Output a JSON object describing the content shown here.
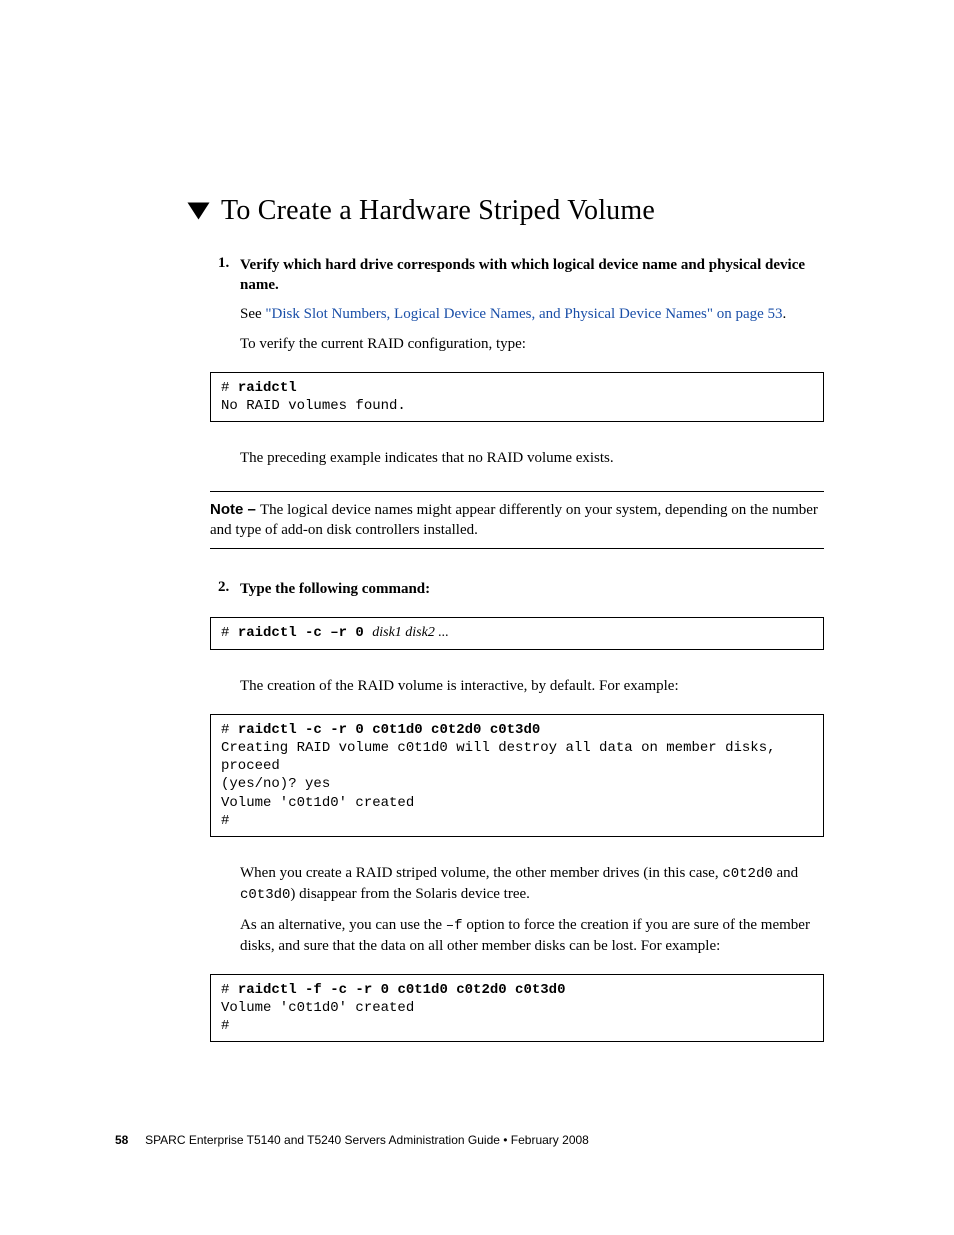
{
  "heading": "To Create a Hardware Striped Volume",
  "step1": {
    "num": "1.",
    "title": "Verify which hard drive corresponds with which logical device name and physical device name.",
    "see_prefix": "See ",
    "link": "\"Disk Slot Numbers, Logical Device Names, and Physical Device Names\" on page 53",
    "see_suffix": ".",
    "verify_text": "To verify the current RAID configuration, type:"
  },
  "code1": {
    "prompt": "# ",
    "cmd": "raidctl",
    "output": "No RAID volumes found."
  },
  "preceding_text": "The preceding example indicates that no RAID volume exists.",
  "note": {
    "label": "Note – ",
    "text": "The logical device names might appear differently on your system, depending on the number and type of add-on disk controllers installed."
  },
  "step2": {
    "num": "2.",
    "title": "Type the following command:"
  },
  "code2": {
    "prompt": "# ",
    "cmd": "raidctl -c –r 0 ",
    "args": "disk1 disk2 ..."
  },
  "creation_text": "The creation of the RAID volume is interactive, by default. For example:",
  "code3": {
    "prompt": "# ",
    "cmd": "raidctl -c -r 0 c0t1d0 c0t2d0 c0t3d0",
    "output": "Creating RAID volume c0t1d0 will destroy all data on member disks,\nproceed\n(yes/no)? yes\nVolume 'c0t1d0' created\n#"
  },
  "when_create_1": "When you create a RAID striped volume, the other member drives (in this case, ",
  "when_create_mono1": "c0t2d0",
  "when_create_2": " and ",
  "when_create_mono2": "c0t3d0",
  "when_create_3": ") disappear from the Solaris device tree.",
  "alt_1": "As an alternative, you can use the ",
  "alt_mono": "–f",
  "alt_2": " option to force the creation if you are sure of the member disks, and sure that the data on all other member disks can be lost. For example:",
  "code4": {
    "prompt": "# ",
    "cmd": "raidctl -f -c -r 0 c0t1d0 c0t2d0 c0t3d0",
    "output": "Volume 'c0t1d0' created\n#"
  },
  "footer": {
    "page": "58",
    "text": "SPARC Enterprise T5140 and T5240 Servers Administration Guide • February 2008"
  }
}
